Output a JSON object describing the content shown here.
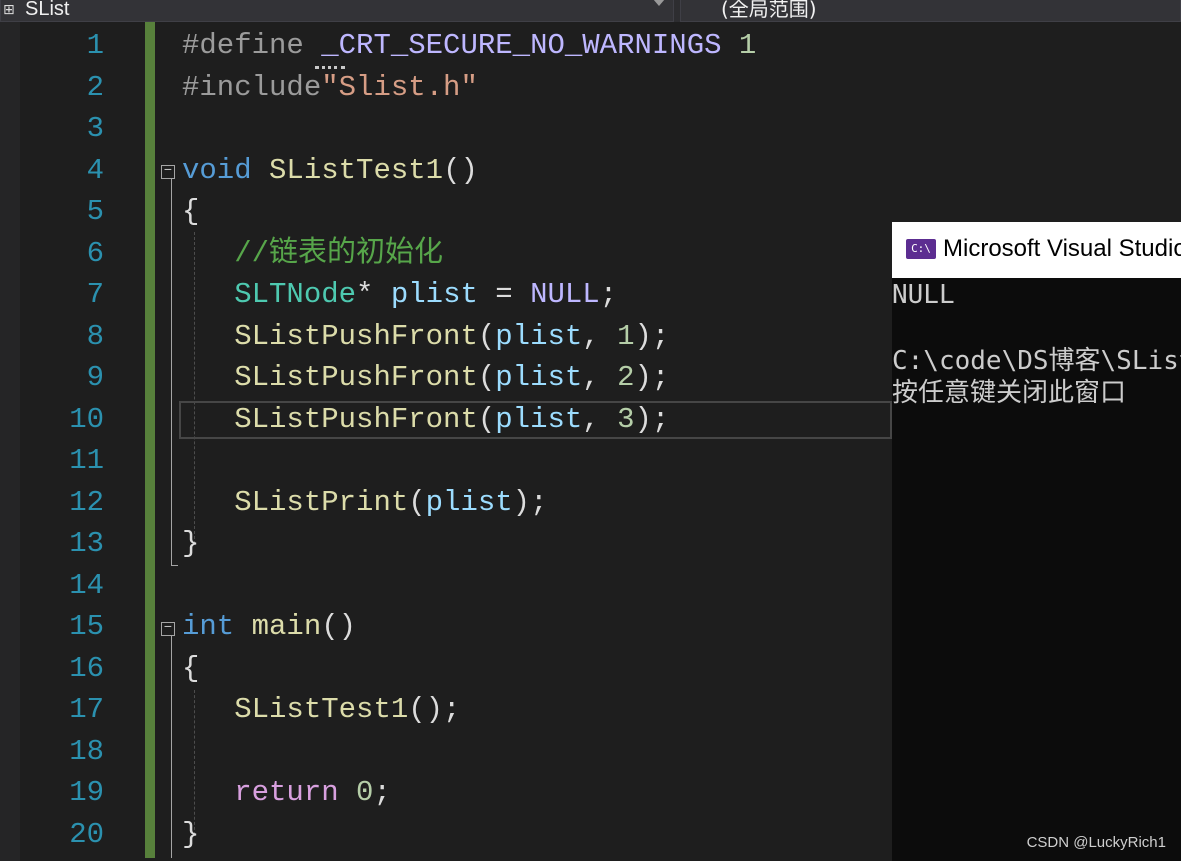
{
  "navbar": {
    "file_name": "SList",
    "scope": "(全局范围)"
  },
  "editor": {
    "line_numbers": [
      "1",
      "2",
      "3",
      "4",
      "5",
      "6",
      "7",
      "8",
      "9",
      "10",
      "11",
      "12",
      "13",
      "14",
      "15",
      "16",
      "17",
      "18",
      "19",
      "20"
    ],
    "fold_toggle_glyph": "−",
    "code": {
      "l1_directive": "#define",
      "l1_macro": "_CRT_SECURE_NO_WARNINGS",
      "l1_value": "1",
      "l2_directive": "#include",
      "l2_header": "\"Slist.h\"",
      "l4_type": "void",
      "l4_name": "SListTest1",
      "l4_parens": "()",
      "l5_brace": "{",
      "l6_comment": "//链表的初始化",
      "l7_type": "SLTNode",
      "l7_star": "*",
      "l7_var": "plist",
      "l7_eq": "=",
      "l7_null": "NULL",
      "l7_semi": ";",
      "push_fn": "SListPushFront",
      "open_paren": "(",
      "push_arg": "plist",
      "comma": ",",
      "close_semi": ");",
      "push_values": [
        "1",
        "2",
        "3"
      ],
      "l12_fn": "SListPrint",
      "l12_arg": "plist",
      "l13_brace": "}",
      "l15_type": "int",
      "l15_name": "main",
      "l15_parens": "()",
      "l16_brace": "{",
      "l17_call": "SListTest1",
      "l17_rest": "();",
      "l19_kw": "return",
      "l19_value": "0",
      "l19_semi": ";",
      "l20_brace": "}"
    }
  },
  "console": {
    "title": "Microsoft Visual Studio",
    "icon_label": "C:\\",
    "output": [
      "NULL",
      "",
      "C:\\code\\DS博客\\SList",
      "按任意键关闭此窗口"
    ]
  },
  "watermark": "CSDN @LuckyRich1",
  "colors": {
    "editor_bg": "#1e1e1e",
    "line_number": "#2b91af",
    "keyword": "#569cd6",
    "function": "#dcdcaa",
    "type": "#4ec9b0",
    "variable": "#9cdcfe",
    "comment": "#57a64a",
    "string": "#d69d85",
    "number": "#b5cea8",
    "macro": "#beb7ff",
    "control_keyword": "#d8a0df",
    "change_bar": "#57803b",
    "console_bg": "#0c0c0c"
  }
}
